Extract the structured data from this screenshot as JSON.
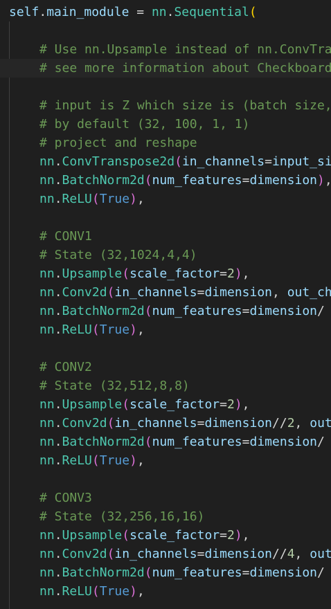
{
  "editor": {
    "lines": [
      {
        "indent": 0,
        "current": false,
        "tokens": [
          {
            "t": "self",
            "c": "self"
          },
          {
            "t": ".",
            "c": "op"
          },
          {
            "t": "main_module",
            "c": "var"
          },
          {
            "t": " = ",
            "c": "op"
          },
          {
            "t": "nn",
            "c": "mod"
          },
          {
            "t": ".",
            "c": "op"
          },
          {
            "t": "Sequential",
            "c": "mod"
          },
          {
            "t": "(",
            "c": "bracket1"
          }
        ]
      },
      {
        "indent": 0,
        "current": false,
        "tokens": []
      },
      {
        "indent": 1,
        "current": false,
        "tokens": [
          {
            "t": "# Use nn.Upsample instead of nn.ConvTra",
            "c": "comment"
          }
        ]
      },
      {
        "indent": 1,
        "current": true,
        "tokens": [
          {
            "t": "# see more information about Checkboard",
            "c": "comment"
          }
        ]
      },
      {
        "indent": 0,
        "current": false,
        "tokens": []
      },
      {
        "indent": 1,
        "current": false,
        "tokens": [
          {
            "t": "# input is Z which size is (batch size,",
            "c": "comment"
          }
        ]
      },
      {
        "indent": 1,
        "current": false,
        "tokens": [
          {
            "t": "# by default (32, 100, 1, 1)",
            "c": "comment"
          }
        ]
      },
      {
        "indent": 1,
        "current": false,
        "tokens": [
          {
            "t": "# project and reshape",
            "c": "comment"
          }
        ]
      },
      {
        "indent": 1,
        "current": false,
        "tokens": [
          {
            "t": "nn",
            "c": "mod"
          },
          {
            "t": ".",
            "c": "op"
          },
          {
            "t": "ConvTranspose2d",
            "c": "mod"
          },
          {
            "t": "(",
            "c": "bracket2"
          },
          {
            "t": "in_channels",
            "c": "param"
          },
          {
            "t": "=",
            "c": "op"
          },
          {
            "t": "input_si",
            "c": "var"
          }
        ]
      },
      {
        "indent": 1,
        "current": false,
        "tokens": [
          {
            "t": "nn",
            "c": "mod"
          },
          {
            "t": ".",
            "c": "op"
          },
          {
            "t": "BatchNorm2d",
            "c": "mod"
          },
          {
            "t": "(",
            "c": "bracket2"
          },
          {
            "t": "num_features",
            "c": "param"
          },
          {
            "t": "=",
            "c": "op"
          },
          {
            "t": "dimension",
            "c": "var"
          },
          {
            "t": ")",
            "c": "bracket2"
          },
          {
            "t": ",",
            "c": "op"
          }
        ]
      },
      {
        "indent": 1,
        "current": false,
        "tokens": [
          {
            "t": "nn",
            "c": "mod"
          },
          {
            "t": ".",
            "c": "op"
          },
          {
            "t": "ReLU",
            "c": "mod"
          },
          {
            "t": "(",
            "c": "bracket2"
          },
          {
            "t": "True",
            "c": "const"
          },
          {
            "t": ")",
            "c": "bracket2"
          },
          {
            "t": ",",
            "c": "op"
          }
        ]
      },
      {
        "indent": 0,
        "current": false,
        "tokens": []
      },
      {
        "indent": 1,
        "current": false,
        "tokens": [
          {
            "t": "# CONV1",
            "c": "comment"
          }
        ]
      },
      {
        "indent": 1,
        "current": false,
        "tokens": [
          {
            "t": "# State (32,1024,4,4)",
            "c": "comment"
          }
        ]
      },
      {
        "indent": 1,
        "current": false,
        "tokens": [
          {
            "t": "nn",
            "c": "mod"
          },
          {
            "t": ".",
            "c": "op"
          },
          {
            "t": "Upsample",
            "c": "mod"
          },
          {
            "t": "(",
            "c": "bracket2"
          },
          {
            "t": "scale_factor",
            "c": "param"
          },
          {
            "t": "=",
            "c": "op"
          },
          {
            "t": "2",
            "c": "num"
          },
          {
            "t": ")",
            "c": "bracket2"
          },
          {
            "t": ",",
            "c": "op"
          }
        ]
      },
      {
        "indent": 1,
        "current": false,
        "tokens": [
          {
            "t": "nn",
            "c": "mod"
          },
          {
            "t": ".",
            "c": "op"
          },
          {
            "t": "Conv2d",
            "c": "mod"
          },
          {
            "t": "(",
            "c": "bracket2"
          },
          {
            "t": "in_channels",
            "c": "param"
          },
          {
            "t": "=",
            "c": "op"
          },
          {
            "t": "dimension",
            "c": "var"
          },
          {
            "t": ", ",
            "c": "op"
          },
          {
            "t": "out_ch",
            "c": "param"
          }
        ]
      },
      {
        "indent": 1,
        "current": false,
        "tokens": [
          {
            "t": "nn",
            "c": "mod"
          },
          {
            "t": ".",
            "c": "op"
          },
          {
            "t": "BatchNorm2d",
            "c": "mod"
          },
          {
            "t": "(",
            "c": "bracket2"
          },
          {
            "t": "num_features",
            "c": "param"
          },
          {
            "t": "=",
            "c": "op"
          },
          {
            "t": "dimension",
            "c": "var"
          },
          {
            "t": "/",
            "c": "op"
          }
        ]
      },
      {
        "indent": 1,
        "current": false,
        "tokens": [
          {
            "t": "nn",
            "c": "mod"
          },
          {
            "t": ".",
            "c": "op"
          },
          {
            "t": "ReLU",
            "c": "mod"
          },
          {
            "t": "(",
            "c": "bracket2"
          },
          {
            "t": "True",
            "c": "const"
          },
          {
            "t": ")",
            "c": "bracket2"
          },
          {
            "t": ",",
            "c": "op"
          }
        ]
      },
      {
        "indent": 0,
        "current": false,
        "tokens": []
      },
      {
        "indent": 1,
        "current": false,
        "tokens": [
          {
            "t": "# CONV2",
            "c": "comment"
          }
        ]
      },
      {
        "indent": 1,
        "current": false,
        "tokens": [
          {
            "t": "# State (32,512,8,8)",
            "c": "comment"
          }
        ]
      },
      {
        "indent": 1,
        "current": false,
        "tokens": [
          {
            "t": "nn",
            "c": "mod"
          },
          {
            "t": ".",
            "c": "op"
          },
          {
            "t": "Upsample",
            "c": "mod"
          },
          {
            "t": "(",
            "c": "bracket2"
          },
          {
            "t": "scale_factor",
            "c": "param"
          },
          {
            "t": "=",
            "c": "op"
          },
          {
            "t": "2",
            "c": "num"
          },
          {
            "t": ")",
            "c": "bracket2"
          },
          {
            "t": ",",
            "c": "op"
          }
        ]
      },
      {
        "indent": 1,
        "current": false,
        "tokens": [
          {
            "t": "nn",
            "c": "mod"
          },
          {
            "t": ".",
            "c": "op"
          },
          {
            "t": "Conv2d",
            "c": "mod"
          },
          {
            "t": "(",
            "c": "bracket2"
          },
          {
            "t": "in_channels",
            "c": "param"
          },
          {
            "t": "=",
            "c": "op"
          },
          {
            "t": "dimension",
            "c": "var"
          },
          {
            "t": "//",
            "c": "op"
          },
          {
            "t": "2",
            "c": "num"
          },
          {
            "t": ", ",
            "c": "op"
          },
          {
            "t": "out",
            "c": "param"
          }
        ]
      },
      {
        "indent": 1,
        "current": false,
        "tokens": [
          {
            "t": "nn",
            "c": "mod"
          },
          {
            "t": ".",
            "c": "op"
          },
          {
            "t": "BatchNorm2d",
            "c": "mod"
          },
          {
            "t": "(",
            "c": "bracket2"
          },
          {
            "t": "num_features",
            "c": "param"
          },
          {
            "t": "=",
            "c": "op"
          },
          {
            "t": "dimension",
            "c": "var"
          },
          {
            "t": "/",
            "c": "op"
          }
        ]
      },
      {
        "indent": 1,
        "current": false,
        "tokens": [
          {
            "t": "nn",
            "c": "mod"
          },
          {
            "t": ".",
            "c": "op"
          },
          {
            "t": "ReLU",
            "c": "mod"
          },
          {
            "t": "(",
            "c": "bracket2"
          },
          {
            "t": "True",
            "c": "const"
          },
          {
            "t": ")",
            "c": "bracket2"
          },
          {
            "t": ",",
            "c": "op"
          }
        ]
      },
      {
        "indent": 0,
        "current": false,
        "tokens": []
      },
      {
        "indent": 1,
        "current": false,
        "tokens": [
          {
            "t": "# CONV3",
            "c": "comment"
          }
        ]
      },
      {
        "indent": 1,
        "current": false,
        "tokens": [
          {
            "t": "# State (32,256,16,16)",
            "c": "comment"
          }
        ]
      },
      {
        "indent": 1,
        "current": false,
        "tokens": [
          {
            "t": "nn",
            "c": "mod"
          },
          {
            "t": ".",
            "c": "op"
          },
          {
            "t": "Upsample",
            "c": "mod"
          },
          {
            "t": "(",
            "c": "bracket2"
          },
          {
            "t": "scale_factor",
            "c": "param"
          },
          {
            "t": "=",
            "c": "op"
          },
          {
            "t": "2",
            "c": "num"
          },
          {
            "t": ")",
            "c": "bracket2"
          },
          {
            "t": ",",
            "c": "op"
          }
        ]
      },
      {
        "indent": 1,
        "current": false,
        "tokens": [
          {
            "t": "nn",
            "c": "mod"
          },
          {
            "t": ".",
            "c": "op"
          },
          {
            "t": "Conv2d",
            "c": "mod"
          },
          {
            "t": "(",
            "c": "bracket2"
          },
          {
            "t": "in_channels",
            "c": "param"
          },
          {
            "t": "=",
            "c": "op"
          },
          {
            "t": "dimension",
            "c": "var"
          },
          {
            "t": "//",
            "c": "op"
          },
          {
            "t": "4",
            "c": "num"
          },
          {
            "t": ", ",
            "c": "op"
          },
          {
            "t": "out",
            "c": "param"
          }
        ]
      },
      {
        "indent": 1,
        "current": false,
        "tokens": [
          {
            "t": "nn",
            "c": "mod"
          },
          {
            "t": ".",
            "c": "op"
          },
          {
            "t": "BatchNorm2d",
            "c": "mod"
          },
          {
            "t": "(",
            "c": "bracket2"
          },
          {
            "t": "num_features",
            "c": "param"
          },
          {
            "t": "=",
            "c": "op"
          },
          {
            "t": "dimension",
            "c": "var"
          },
          {
            "t": "/",
            "c": "op"
          }
        ]
      },
      {
        "indent": 1,
        "current": false,
        "tokens": [
          {
            "t": "nn",
            "c": "mod"
          },
          {
            "t": ".",
            "c": "op"
          },
          {
            "t": "ReLU",
            "c": "mod"
          },
          {
            "t": "(",
            "c": "bracket2"
          },
          {
            "t": "True",
            "c": "const"
          },
          {
            "t": ")",
            "c": "bracket2"
          },
          {
            "t": ",",
            "c": "op"
          }
        ]
      }
    ]
  }
}
